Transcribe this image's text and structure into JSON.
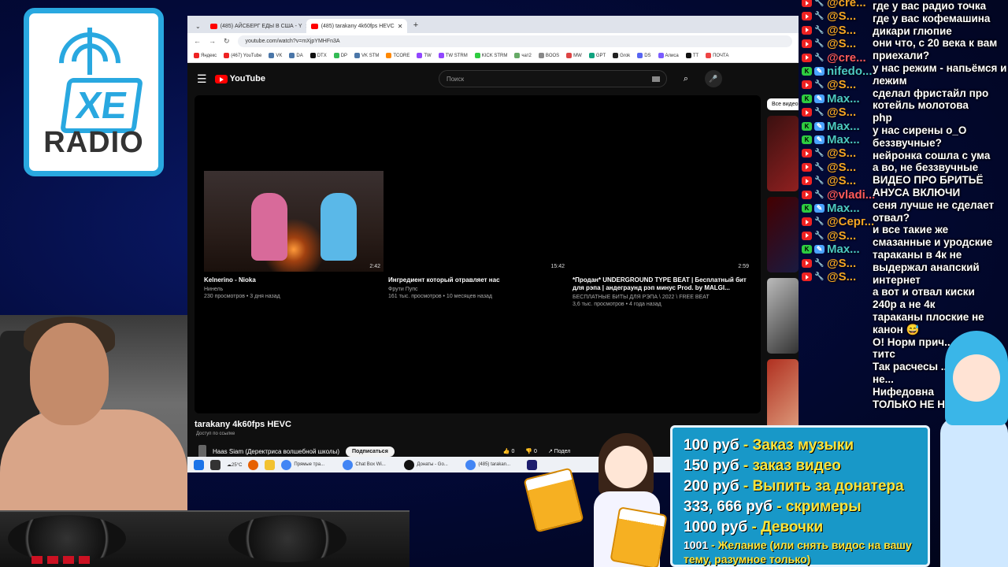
{
  "logo": {
    "brand": "XE",
    "word": "RADIO"
  },
  "browser": {
    "tabs": [
      {
        "label": "(485) АЙСБЕРГ ЕДЫ В США - Y",
        "active": false
      },
      {
        "label": "(485) tarakany 4k60fps HEVC",
        "active": true
      }
    ],
    "new_tab": "+",
    "url": "youtube.com/watch?v=mXjpYMHFn3A",
    "bookmarks": [
      "Яндекс",
      "(467) YouTube",
      "VK",
      "DA",
      "DTX",
      "DP",
      "VK STM",
      "TCORE",
      "TW",
      "TW STRM",
      "KICK STRM",
      "чат2",
      "BOOS",
      "MW",
      "GPT",
      "Grok",
      "DS",
      "Алиса",
      "TT",
      "ПОЧТА"
    ]
  },
  "youtube": {
    "logo_text": "YouTube",
    "search_placeholder": "Поиск",
    "endscreen": [
      {
        "title": "Kelnerino - Nioka",
        "channel": "Нинель",
        "meta": "230 просмотров • 3 дня назад",
        "duration": "2:42"
      },
      {
        "title": "Ингредиент который отравляет нас",
        "channel": "Фрути Пупс",
        "meta": "161 тыс. просмотров • 10 месяцев назад",
        "duration": "15:42"
      },
      {
        "title": "*Продан* UNDERGROUND TYPE BEAT | Бесплатный бит для рэпа | андеграунд рэп минус Prod. by MALGI...",
        "channel": "БЕСПЛАТНЫЕ БИТЫ ДЛЯ РЭПА \\ 2022 \\ FREE BEAT",
        "meta": "3,6 тыс. просмотров • 4 года назад",
        "duration": "2:59"
      }
    ],
    "video_title": "tarakany 4k60fps HEVC",
    "access_note": "Доступ по ссылке",
    "channel_name": "Haas Siam (Деректриса волшебной школы)",
    "subscribe_label": "Подписаться",
    "likes": "0",
    "dislikes": "0",
    "share_label": "Подел",
    "sidebar_chip": "Все видео"
  },
  "taskbar": {
    "weather": "25°C",
    "apps": [
      "Прямые тра...",
      "Chat Box Wi...",
      "Донаты - Go...",
      "(485) tarakan..."
    ]
  },
  "chat": {
    "users": [
      {
        "name": "@cre...",
        "color": "orange",
        "badges": [
          "yt",
          "wrench"
        ]
      },
      {
        "name": "@S...",
        "color": "orange",
        "badges": [
          "yt",
          "wrench"
        ]
      },
      {
        "name": "@S...",
        "color": "orange",
        "badges": [
          "yt",
          "wrench"
        ]
      },
      {
        "name": "@S...",
        "color": "orange",
        "badges": [
          "yt",
          "wrench"
        ]
      },
      {
        "name": "@cre...",
        "color": "red",
        "badges": [
          "yt",
          "wrench"
        ]
      },
      {
        "name": "nifedo...",
        "color": "teal",
        "badges": [
          "kick",
          "wrench-blue"
        ]
      },
      {
        "name": "@S...",
        "color": "orange",
        "badges": [
          "yt",
          "wrench"
        ]
      },
      {
        "name": "Max...",
        "color": "teal",
        "badges": [
          "kick",
          "wrench-blue"
        ]
      },
      {
        "name": "@S...",
        "color": "orange",
        "badges": [
          "yt",
          "wrench"
        ]
      },
      {
        "name": "Max...",
        "color": "teal",
        "badges": [
          "kick",
          "wrench-blue"
        ]
      },
      {
        "name": "Max...",
        "color": "teal",
        "badges": [
          "kick",
          "wrench-blue"
        ]
      },
      {
        "name": "@S...",
        "color": "orange",
        "badges": [
          "yt",
          "wrench"
        ]
      },
      {
        "name": "@S...",
        "color": "orange",
        "badges": [
          "yt",
          "wrench"
        ]
      },
      {
        "name": "@S...",
        "color": "orange",
        "badges": [
          "yt",
          "wrench"
        ]
      },
      {
        "name": "@vladi...",
        "color": "red",
        "badges": [
          "yt",
          "wrench"
        ]
      },
      {
        "name": "Max...",
        "color": "teal",
        "badges": [
          "kick",
          "wrench-blue"
        ]
      },
      {
        "name": "@Серг...",
        "color": "orange",
        "badges": [
          "yt",
          "wrench"
        ]
      },
      {
        "name": "@S...",
        "color": "orange",
        "badges": [
          "yt",
          "wrench"
        ]
      },
      {
        "name": "Max...",
        "color": "teal",
        "badges": [
          "kick",
          "wrench-blue"
        ]
      },
      {
        "name": "@S...",
        "color": "orange",
        "badges": [
          "yt",
          "wrench"
        ]
      },
      {
        "name": "@S...",
        "color": "orange",
        "badges": [
          "yt",
          "wrench"
        ]
      }
    ],
    "messages": [
      "где у вас радио точка",
      "где у вас кофемашина",
      "дикари глюпие",
      "они что, с 20 века к вам приехали?",
      "у нас режим - напьёмся и лежим",
      "сделал фристайл про котейль молотова",
      "php",
      "у нас сирены о_О беззвучные?",
      "нейронка сошла с ума",
      "а во, не беззвучные",
      "ВИДЕО ПРО БРИТЬЁ АНУСА ВКЛЮЧИ",
      "сеня лучше не сделает отвал?",
      "и все такие же смазанные и уродские тараканы в 4к не выдержал анапский интернет",
      "а вот и отвал киски",
      "240р а не 4к",
      "тараканы плоские не канон 😅",
      "О! Норм прич...",
      "титс",
      "Так расчесы ... стороны а не...",
      "Нифедовна",
      "ТОЛЬКО НЕ Н..."
    ]
  },
  "donations": [
    {
      "price": "100 руб",
      "what": "Заказ музыки"
    },
    {
      "price": "150 руб",
      "what": "заказ видео"
    },
    {
      "price": "200 руб",
      "what": "Выпить за донатера"
    },
    {
      "price": "333, 666 руб",
      "what": "скримеры"
    },
    {
      "price": "1000 руб",
      "what": "Девочки"
    },
    {
      "price": "1001",
      "what": "Желание (или снять видос на вашу тему, разумное только)"
    }
  ],
  "colors": {
    "accent": "#29a8e0",
    "yt_red": "#ff0000",
    "kick_green": "#2ecc40",
    "donate_bg": "#1898c8",
    "donate_text": "#ffe43a"
  }
}
